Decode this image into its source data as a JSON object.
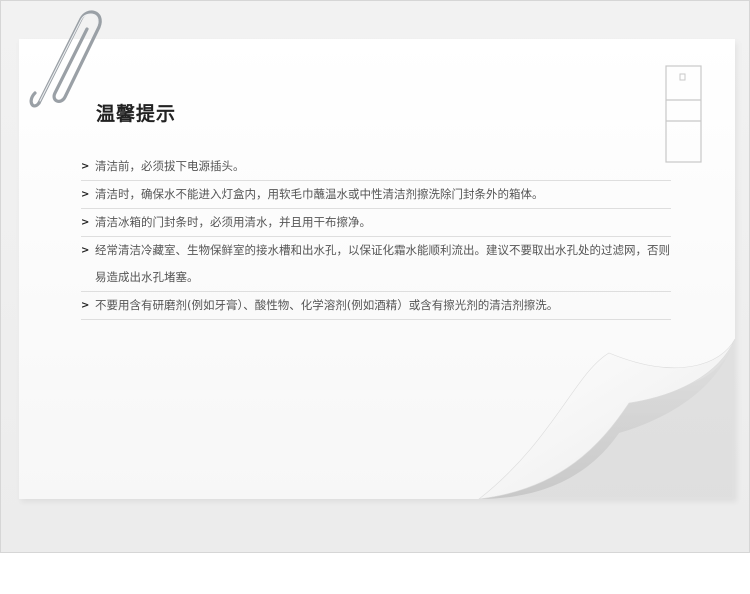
{
  "title": "温馨提示",
  "tips": [
    "清洁前，必须拔下电源插头。",
    "清洁时，确保水不能进入灯盒内，用软毛巾蘸温水或中性清洁剂擦洗除门封条外的箱体。",
    "清洁冰箱的门封条时，必须用清水，并且用干布擦净。",
    "经常清洁冷藏室、生物保鲜室的接水槽和出水孔，以保证化霜水能顺利流出。建议不要取出水孔处的过滤网，否则易造成出水孔堵塞。",
    "不要用含有研磨剂(例如牙膏）、酸性物、化学溶剂(例如酒精）或含有擦光剂的清洁剂擦洗。"
  ],
  "icons": {
    "paperclip": "paperclip-icon",
    "refrigerator": "refrigerator-icon",
    "bullet": "chevron-right-icon"
  },
  "colors": {
    "background": "#efefef",
    "paper": "#ffffff",
    "title": "#222222",
    "text": "#555555",
    "divider": "#dedede"
  }
}
